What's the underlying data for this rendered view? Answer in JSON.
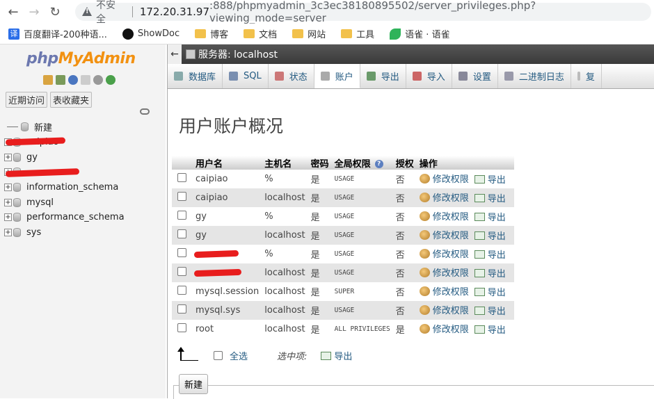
{
  "browser": {
    "insecure_label": "不安全",
    "url_host": "172.20.31.97",
    "url_rest": ":888/phpmyadmin_3c3ec38180895502/server_privileges.php?viewing_mode=server",
    "bookmarks": [
      "百度翻译-200种语...",
      "ShowDoc",
      "博客",
      "文档",
      "网站",
      "工具",
      "语雀 · 语雀"
    ]
  },
  "sidebar": {
    "logo_php": "php",
    "logo_my": "MyAdmin",
    "quick_tabs": [
      "近期访问",
      "表收藏夹"
    ],
    "tree": [
      {
        "label": "新建",
        "kind": "new"
      },
      {
        "label": "caipiao",
        "kind": "db",
        "redacted": true
      },
      {
        "label": "gy",
        "kind": "db"
      },
      {
        "label": "",
        "kind": "db",
        "redacted": true
      },
      {
        "label": "information_schema",
        "kind": "db"
      },
      {
        "label": "mysql",
        "kind": "db"
      },
      {
        "label": "performance_schema",
        "kind": "db"
      },
      {
        "label": "sys",
        "kind": "db"
      }
    ]
  },
  "main": {
    "server_label": "服务器: localhost",
    "tabs": [
      "数据库",
      "SQL",
      "状态",
      "账户",
      "导出",
      "导入",
      "设置",
      "二进制日志",
      "复"
    ],
    "active_tab": "账户",
    "page_title": "用户账户概况",
    "columns": [
      "用户名",
      "主机名",
      "密码",
      "全局权限",
      "授权",
      "操作"
    ],
    "rows": [
      {
        "user": "caipiao",
        "host": "%",
        "password": "是",
        "privileges": "USAGE",
        "grant": "否"
      },
      {
        "user": "caipiao",
        "host": "localhost",
        "password": "是",
        "privileges": "USAGE",
        "grant": "否"
      },
      {
        "user": "gy",
        "host": "%",
        "password": "是",
        "privileges": "USAGE",
        "grant": "否"
      },
      {
        "user": "gy",
        "host": "localhost",
        "password": "是",
        "privileges": "USAGE",
        "grant": "否"
      },
      {
        "user": "",
        "host": "%",
        "password": "是",
        "privileges": "USAGE",
        "grant": "否",
        "redacted": true
      },
      {
        "user": "",
        "host": "localhost",
        "password": "是",
        "privileges": "USAGE",
        "grant": "否",
        "redacted": true
      },
      {
        "user": "mysql.session",
        "host": "localhost",
        "password": "是",
        "privileges": "SUPER",
        "grant": "否"
      },
      {
        "user": "mysql.sys",
        "host": "localhost",
        "password": "是",
        "privileges": "USAGE",
        "grant": "否"
      },
      {
        "user": "root",
        "host": "localhost",
        "password": "是",
        "privileges": "ALL PRIVILEGES",
        "grant": "是"
      }
    ],
    "action_edit": "修改权限",
    "action_export": "导出",
    "check_all": "全选",
    "with_selected": "选中项:",
    "bottom_export": "导出",
    "new_button": "新建"
  }
}
